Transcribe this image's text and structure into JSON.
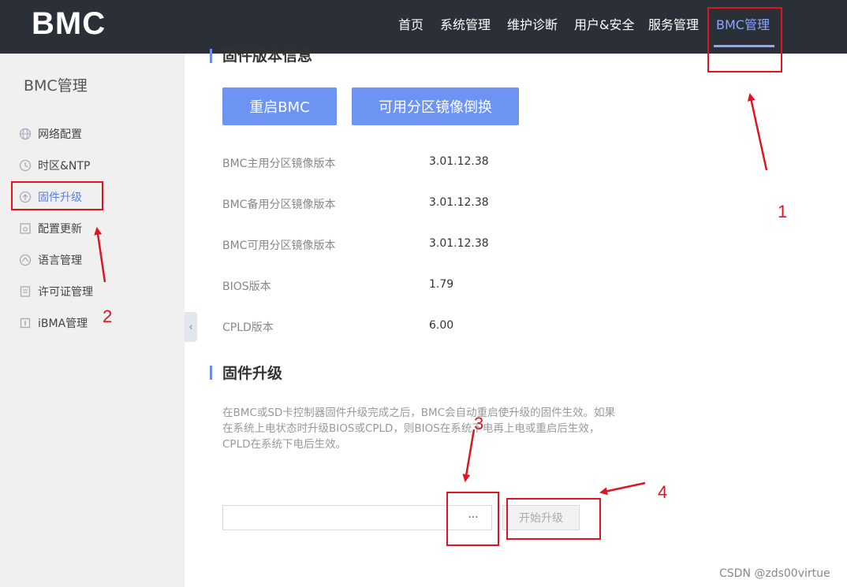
{
  "header": {
    "logo": "BMC",
    "nav": [
      "首页",
      "系统管理",
      "维护诊断",
      "用户&安全",
      "服务管理",
      "BMC管理"
    ],
    "active_nav": "BMC管理"
  },
  "sidebar": {
    "title": "BMC管理",
    "items": [
      {
        "label": "网络配置",
        "icon": "globe-icon"
      },
      {
        "label": "时区&NTP",
        "icon": "clock-icon"
      },
      {
        "label": "固件升级",
        "icon": "upgrade-icon",
        "active": true
      },
      {
        "label": "配置更新",
        "icon": "config-icon"
      },
      {
        "label": "语言管理",
        "icon": "language-icon"
      },
      {
        "label": "许可证管理",
        "icon": "license-icon"
      },
      {
        "label": "iBMA管理",
        "icon": "ibma-icon"
      }
    ],
    "collapse_glyph": "‹"
  },
  "main": {
    "section1_title": "固件版本信息",
    "buttons": {
      "restart": "重启BMC",
      "swap": "可用分区镜像倒换"
    },
    "versions": [
      {
        "label": "BMC主用分区镜像版本",
        "value": "3.01.12.38"
      },
      {
        "label": "BMC备用分区镜像版本",
        "value": "3.01.12.38"
      },
      {
        "label": "BMC可用分区镜像版本",
        "value": "3.01.12.38"
      },
      {
        "label": "BIOS版本",
        "value": "1.79"
      },
      {
        "label": "CPLD版本",
        "value": "6.00"
      }
    ],
    "section2_title": "固件升级",
    "description": "在BMC或SD卡控制器固件升级完成之后，BMC会自动重启使升级的固件生效。如果在系统上电状态时升级BIOS或CPLD，则BIOS在系统下电再上电或重启后生效，CPLD在系统下电后生效。",
    "file_input_value": "",
    "browse_label": "···",
    "upgrade_button": "开始升级"
  },
  "annotations": {
    "n1": "1",
    "n2": "2",
    "n3": "3",
    "n4": "4",
    "color": "#e0141e"
  },
  "watermark": "CSDN @zds00virtue"
}
